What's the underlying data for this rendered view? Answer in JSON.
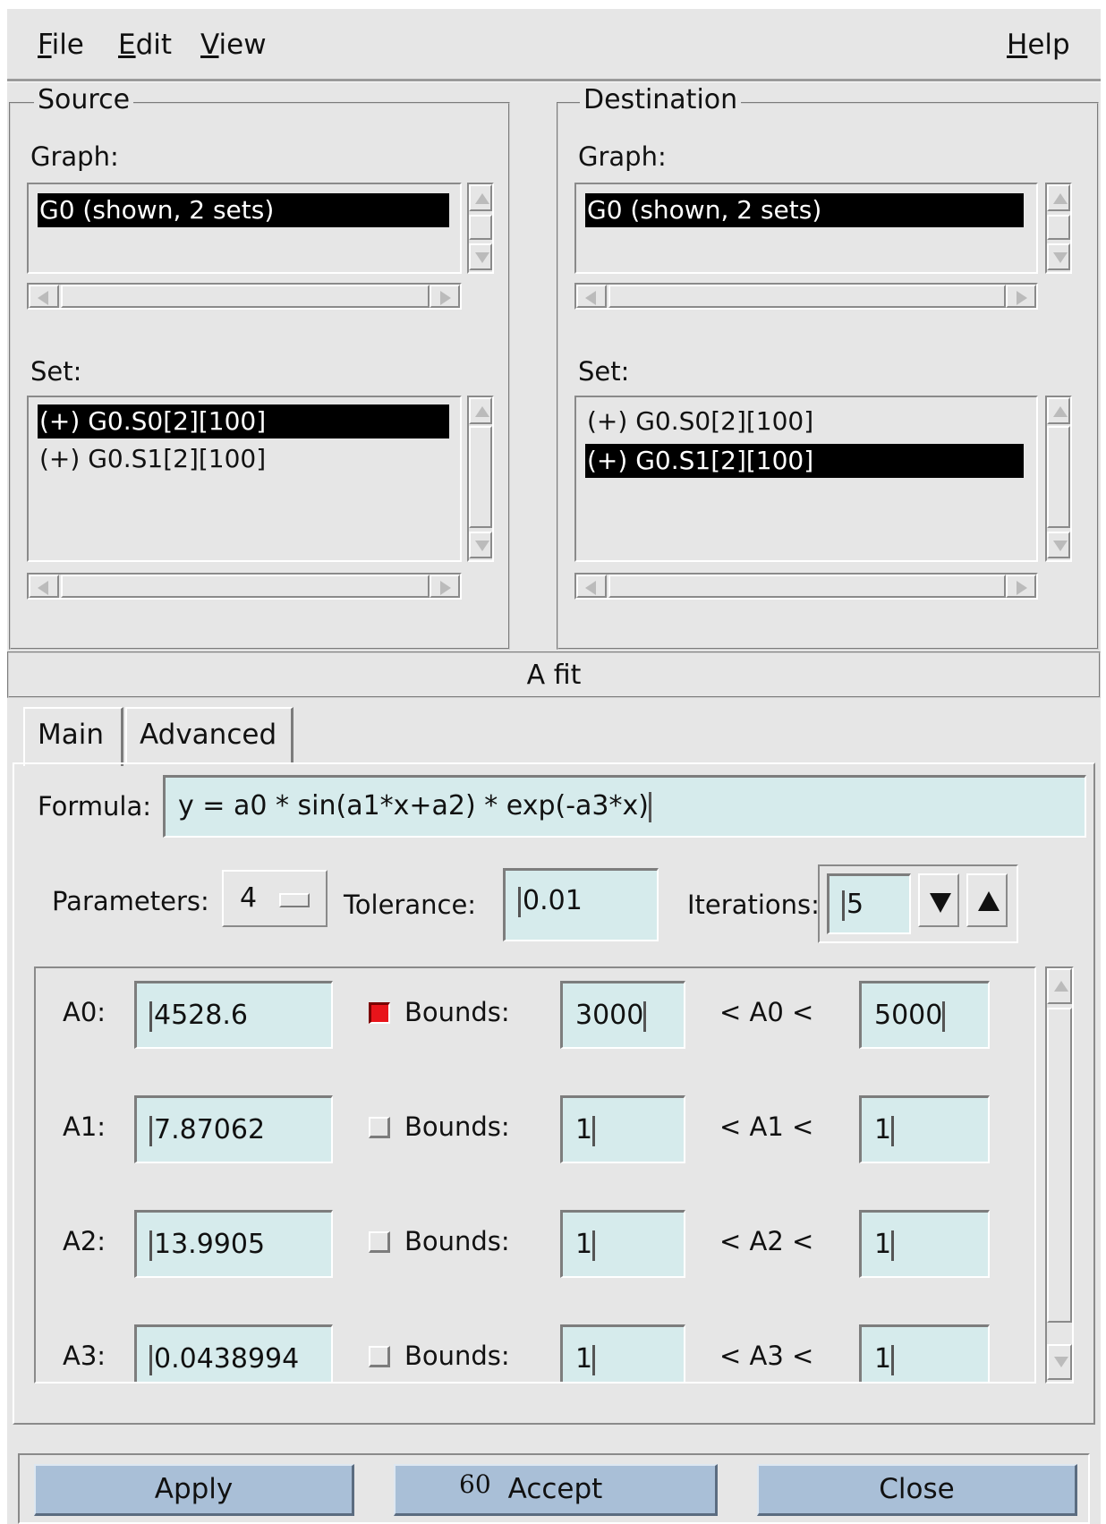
{
  "menu": {
    "file": {
      "mnemonic": "F",
      "rest": "ile"
    },
    "edit": {
      "mnemonic": "E",
      "rest": "dit"
    },
    "view": {
      "mnemonic": "V",
      "rest": "iew"
    },
    "help": {
      "mnemonic": "H",
      "rest": "elp"
    }
  },
  "source": {
    "legend": "Source",
    "graph_label": "Graph:",
    "graphs": [
      "G0 (shown, 2 sets)"
    ],
    "set_label": "Set:",
    "sets": [
      "(+) G0.S0[2][100]",
      "(+) G0.S1[2][100]"
    ],
    "selected_set": "(+) G0.S0[2][100]"
  },
  "destination": {
    "legend": "Destination",
    "graph_label": "Graph:",
    "graphs": [
      "G0 (shown, 2 sets)"
    ],
    "set_label": "Set:",
    "sets": [
      "(+) G0.S0[2][100]",
      "(+) G0.S1[2][100]"
    ],
    "selected_set": "(+) G0.S1[2][100]"
  },
  "fit_title": "A fit",
  "tabs": [
    "Main",
    "Advanced"
  ],
  "main": {
    "formula_label": "Formula:",
    "formula": "y = a0 * sin(a1*x+a2) * exp(-a3*x)",
    "parameters_label": "Parameters:",
    "parameters": "4",
    "tolerance_label": "Tolerance:",
    "tolerance": "0.01",
    "iterations_label": "Iterations:",
    "iterations": "5",
    "params": [
      {
        "label": "A0:",
        "value": "4528.6",
        "bounded": true,
        "bounds_label": "Bounds:",
        "lower": "3000",
        "mid": "< A0 <",
        "upper": "5000"
      },
      {
        "label": "A1:",
        "value": "7.87062",
        "bounded": false,
        "bounds_label": "Bounds:",
        "lower": "1",
        "mid": "< A1 <",
        "upper": "1"
      },
      {
        "label": "A2:",
        "value": "13.9905",
        "bounded": false,
        "bounds_label": "Bounds:",
        "lower": "1",
        "mid": "< A2 <",
        "upper": "1"
      },
      {
        "label": "A3:",
        "value": "0.0438994",
        "bounded": false,
        "bounds_label": "Bounds:",
        "lower": "1",
        "mid": "< A3 <",
        "upper": "1"
      }
    ]
  },
  "buttons": {
    "apply": "Apply",
    "accept": "Accept",
    "close": "Close"
  },
  "page_number": "60",
  "colors": {
    "window": "#e6e6e6",
    "field": "#d6ebec",
    "button": "#a9bfd7",
    "check_on": "#e8141a",
    "selection": "#000000"
  }
}
